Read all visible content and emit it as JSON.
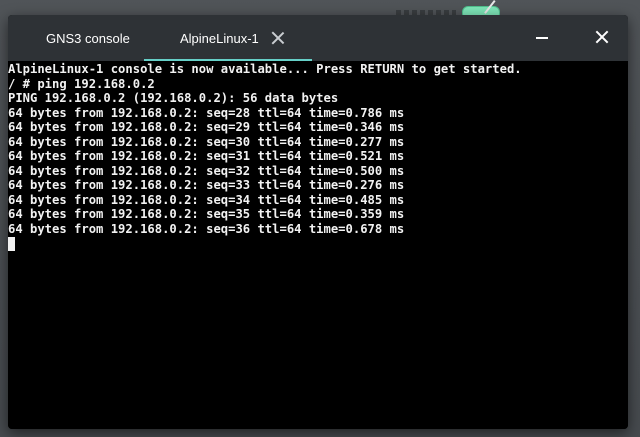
{
  "window": {
    "tabs": [
      {
        "label": "GNS3 console",
        "active": false
      },
      {
        "label": "AlpineLinux-1",
        "active": true
      }
    ]
  },
  "colors": {
    "titlebar": "#2e3236",
    "active_tab_indicator": "#66d0c8",
    "terminal_bg": "#000000",
    "terminal_fg": "#f2f2f2"
  },
  "terminal": {
    "lines": [
      "AlpineLinux-1 console is now available... Press RETURN to get started.",
      "/ # ping 192.168.0.2",
      "PING 192.168.0.2 (192.168.0.2): 56 data bytes",
      "64 bytes from 192.168.0.2: seq=28 ttl=64 time=0.786 ms",
      "64 bytes from 192.168.0.2: seq=29 ttl=64 time=0.346 ms",
      "64 bytes from 192.168.0.2: seq=30 ttl=64 time=0.277 ms",
      "64 bytes from 192.168.0.2: seq=31 ttl=64 time=0.521 ms",
      "64 bytes from 192.168.0.2: seq=32 ttl=64 time=0.500 ms",
      "64 bytes from 192.168.0.2: seq=33 ttl=64 time=0.276 ms",
      "64 bytes from 192.168.0.2: seq=34 ttl=64 time=0.485 ms",
      "64 bytes from 192.168.0.2: seq=35 ttl=64 time=0.359 ms",
      "64 bytes from 192.168.0.2: seq=36 ttl=64 time=0.678 ms"
    ]
  }
}
